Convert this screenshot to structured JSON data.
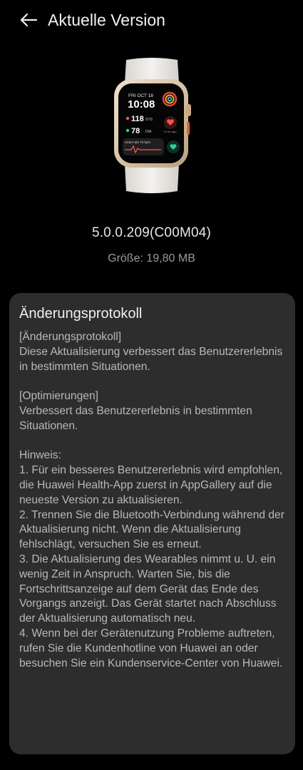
{
  "header": {
    "title": "Aktuelle Version"
  },
  "watch": {
    "date": "FRI OCT 18",
    "time": "10:08",
    "sys_value": "118",
    "sys_unit": "SYS",
    "dia_value": "78",
    "dia_unit": "DIA",
    "ago": "5 min ago",
    "heart_rate": "Heart rate 76 bpm"
  },
  "version": {
    "number": "5.0.0.209(C00M04)",
    "size_label": "Größe:",
    "size_value": "19,80 MB"
  },
  "changelog": {
    "title": "Änderungsprotokoll",
    "paragraphs": [
      [
        "[Änderungsprotokoll]",
        "Diese Aktualisierung verbessert das Benutzererlebnis in bestimmten Situationen."
      ],
      [
        "[Optimierungen]",
        "Verbessert das Benutzererlebnis in bestimmten Situationen."
      ],
      [
        "Hinweis:",
        "1. Für ein besseres Benutzererlebnis wird empfohlen, die Huawei Health-App zuerst in AppGallery auf die neueste Version zu aktualisieren.",
        "2. Trennen Sie die Bluetooth-Verbindung während der Aktualisierung nicht. Wenn die Aktualisierung fehlschlägt, versuchen Sie es erneut.",
        "3. Die Aktualisierung des Wearables nimmt u. U. ein wenig Zeit in Anspruch. Warten Sie, bis die Fortschrittsanzeige auf dem Gerät das Ende des Vorgangs anzeigt. Das Gerät startet nach Abschluss der Aktualisierung automatisch neu.",
        "4. Wenn bei der Gerätenutzung Probleme auftreten, rufen Sie die Kundenhotline von Huawei an oder besuchen Sie ein Kundenservice-Center von Huawei."
      ]
    ]
  }
}
